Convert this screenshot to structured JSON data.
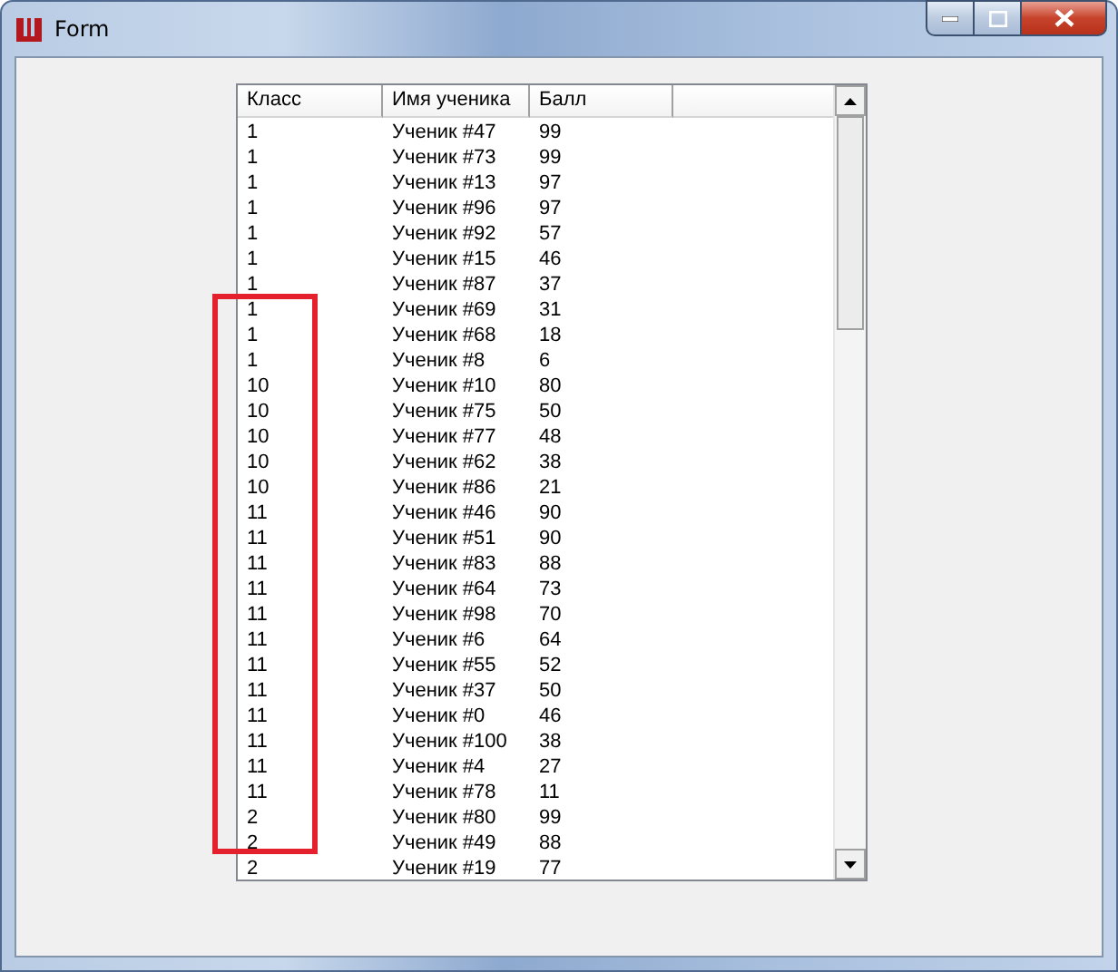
{
  "window": {
    "title": "Form"
  },
  "table": {
    "columns": [
      "Класс",
      "Имя ученика",
      "Балл"
    ],
    "rows": [
      [
        "1",
        "Ученик #47",
        "99"
      ],
      [
        "1",
        "Ученик #73",
        "99"
      ],
      [
        "1",
        "Ученик #13",
        "97"
      ],
      [
        "1",
        "Ученик #96",
        "97"
      ],
      [
        "1",
        "Ученик #92",
        "57"
      ],
      [
        "1",
        "Ученик #15",
        "46"
      ],
      [
        "1",
        "Ученик #87",
        "37"
      ],
      [
        "1",
        "Ученик #69",
        "31"
      ],
      [
        "1",
        "Ученик #68",
        "18"
      ],
      [
        "1",
        "Ученик #8",
        "6"
      ],
      [
        "10",
        "Ученик #10",
        "80"
      ],
      [
        "10",
        "Ученик #75",
        "50"
      ],
      [
        "10",
        "Ученик #77",
        "48"
      ],
      [
        "10",
        "Ученик #62",
        "38"
      ],
      [
        "10",
        "Ученик #86",
        "21"
      ],
      [
        "11",
        "Ученик #46",
        "90"
      ],
      [
        "11",
        "Ученик #51",
        "90"
      ],
      [
        "11",
        "Ученик #83",
        "88"
      ],
      [
        "11",
        "Ученик #64",
        "73"
      ],
      [
        "11",
        "Ученик #98",
        "70"
      ],
      [
        "11",
        "Ученик #6",
        "64"
      ],
      [
        "11",
        "Ученик #55",
        "52"
      ],
      [
        "11",
        "Ученик #37",
        "50"
      ],
      [
        "11",
        "Ученик #0",
        "46"
      ],
      [
        "11",
        "Ученик #100",
        "38"
      ],
      [
        "11",
        "Ученик #4",
        "27"
      ],
      [
        "11",
        "Ученик #78",
        "11"
      ],
      [
        "2",
        "Ученик #80",
        "99"
      ],
      [
        "2",
        "Ученик #49",
        "88"
      ],
      [
        "2",
        "Ученик #19",
        "77"
      ]
    ]
  },
  "annotation": {
    "kind": "rectangle",
    "color": "#e3202b"
  }
}
